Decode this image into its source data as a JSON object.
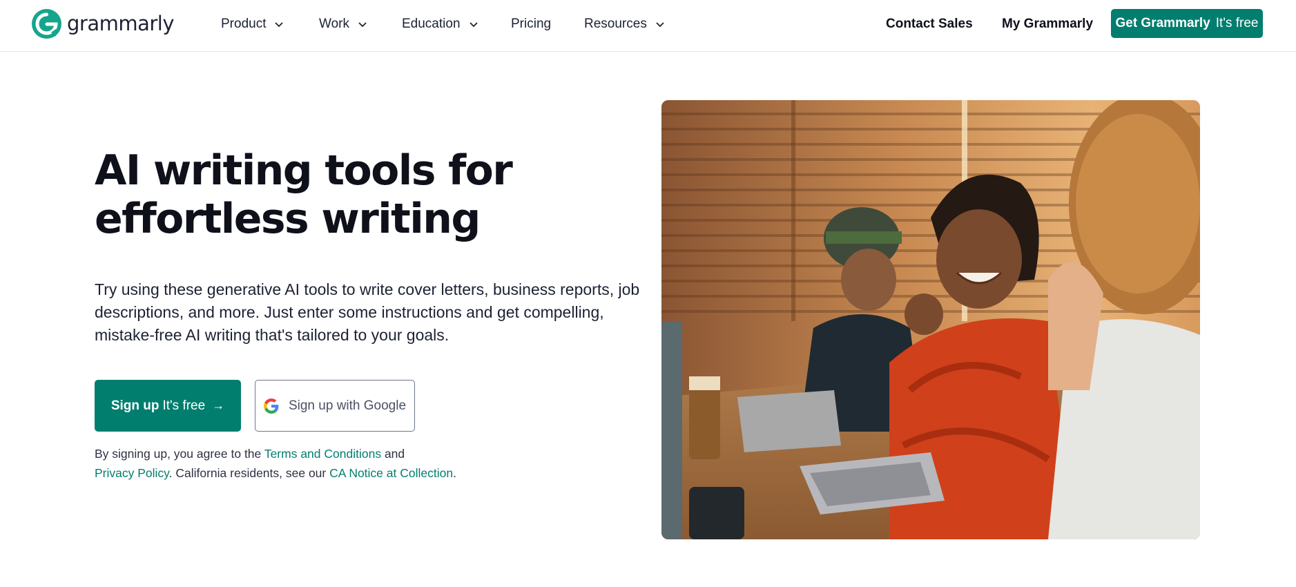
{
  "nav": {
    "logo_text": "grammarly",
    "items": [
      {
        "label": "Product",
        "has_dropdown": true
      },
      {
        "label": "Work",
        "has_dropdown": true
      },
      {
        "label": "Education",
        "has_dropdown": true
      },
      {
        "label": "Pricing",
        "has_dropdown": false
      },
      {
        "label": "Resources",
        "has_dropdown": true
      }
    ],
    "contact_sales": "Contact Sales",
    "my_grammarly": "My Grammarly",
    "cta": {
      "strong": "Get Grammarly",
      "light": "It's free"
    }
  },
  "hero": {
    "title_line1": "AI writing tools for",
    "title_line2": "effortless writing",
    "description": "Try using these generative AI tools to write cover letters, business reports, job descriptions, and more. Just enter some instructions and get compelling, mistake-free AI writing that's tailored to your goals.",
    "signup_button": {
      "strong": "Sign up",
      "light": "It's free",
      "arrow": "→"
    },
    "google_button": "Sign up with Google",
    "legal": {
      "part1": "By signing up, you agree to the ",
      "terms_link": "Terms and Conditions",
      "part2": " and",
      "privacy_link": "Privacy Policy",
      "part3": ". California residents, see our ",
      "ca_link": "CA Notice at Collection",
      "part4": "."
    }
  },
  "colors": {
    "brand": "#027e6f",
    "text": "#0e101a",
    "border": "#e4e6ea"
  },
  "icons": {
    "logo": "grammarly-logo-icon",
    "dropdown": "chevron-down-icon",
    "google": "google-icon",
    "arrow": "arrow-right-icon"
  }
}
